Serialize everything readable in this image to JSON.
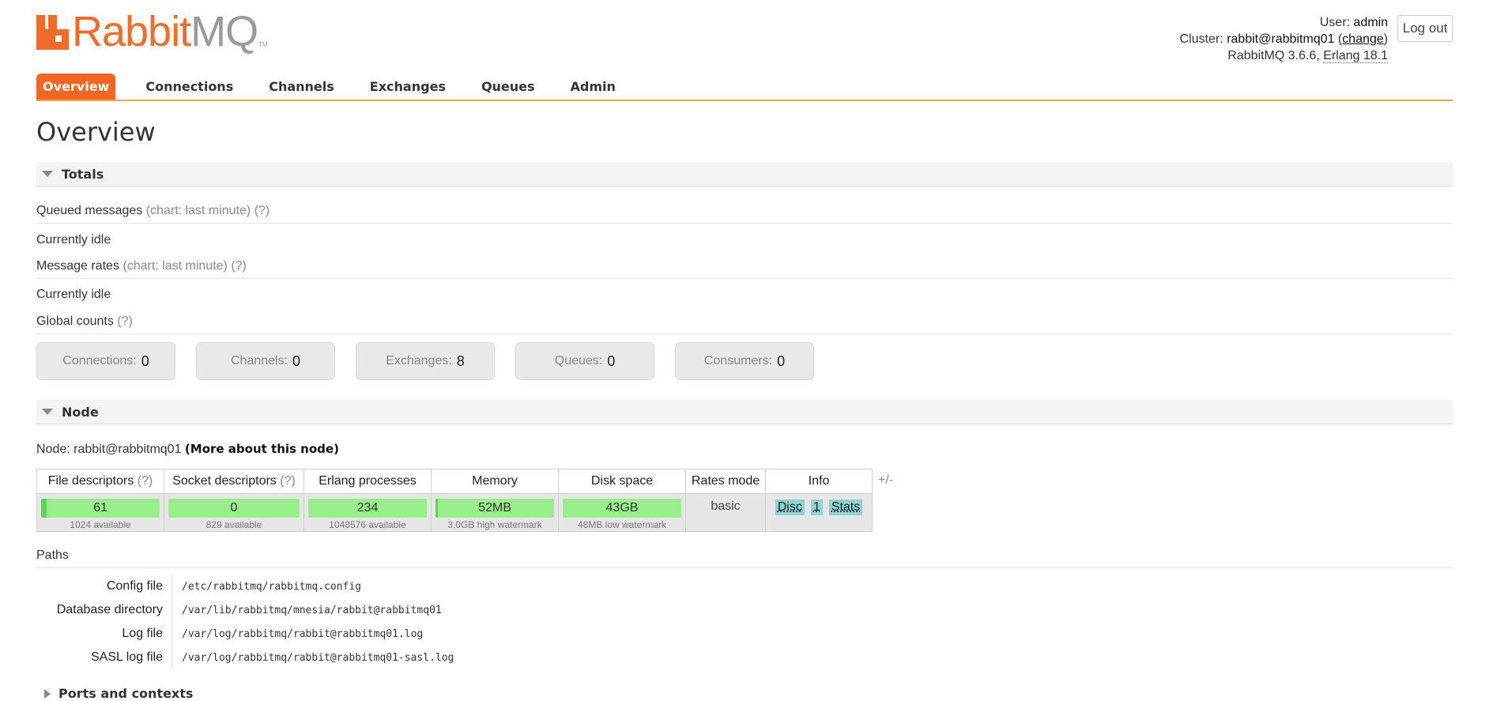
{
  "logo": {
    "rabbit": "Rabbit",
    "mq": "MQ",
    "tm": "TM"
  },
  "header": {
    "user_label": "User:",
    "user": "admin",
    "cluster_label": "Cluster:",
    "cluster": "rabbit@rabbitmq01",
    "change": "change",
    "version": "RabbitMQ 3.6.6,",
    "erlang": "Erlang 18.1",
    "logout": "Log out"
  },
  "tabs": [
    "Overview",
    "Connections",
    "Channels",
    "Exchanges",
    "Queues",
    "Admin"
  ],
  "page_title": "Overview",
  "totals": {
    "title": "Totals",
    "queued_messages": "Queued messages",
    "queued_chart": "(chart: last minute)",
    "help": "(?)",
    "queued_idle": "Currently idle",
    "message_rates": "Message rates",
    "rates_chart": "(chart: last minute)",
    "rates_idle": "Currently idle",
    "global_counts": "Global counts",
    "counts": [
      {
        "label": "Connections:",
        "value": "0"
      },
      {
        "label": "Channels:",
        "value": "0"
      },
      {
        "label": "Exchanges:",
        "value": "8"
      },
      {
        "label": "Queues:",
        "value": "0"
      },
      {
        "label": "Consumers:",
        "value": "0"
      }
    ]
  },
  "node": {
    "title": "Node",
    "node_label": "Node:",
    "node_name": "rabbit@rabbitmq01",
    "more": "(More about this node)",
    "headers": [
      "File descriptors",
      "Socket descriptors",
      "Erlang processes",
      "Memory",
      "Disk space",
      "Rates mode",
      "Info"
    ],
    "help": "(?)",
    "fd": {
      "value": "61",
      "sub": "1024 available"
    },
    "sockets": {
      "value": "0",
      "sub": "829 available"
    },
    "procs": {
      "value": "234",
      "sub": "1048576 available"
    },
    "memory": {
      "value": "52MB",
      "sub": "3.0GB high watermark"
    },
    "disk": {
      "value": "43GB",
      "sub": "48MB low watermark"
    },
    "rates_mode": "basic",
    "info": [
      "Disc",
      "1",
      "Stats"
    ],
    "plusminus": "+/-"
  },
  "paths": {
    "title": "Paths",
    "rows": [
      {
        "k": "Config file",
        "v": "/etc/rabbitmq/rabbitmq.config"
      },
      {
        "k": "Database directory",
        "v": "/var/lib/rabbitmq/mnesia/rabbit@rabbitmq01"
      },
      {
        "k": "Log file",
        "v": "/var/log/rabbitmq/rabbit@rabbitmq01.log"
      },
      {
        "k": "SASL log file",
        "v": "/var/log/rabbitmq/rabbit@rabbitmq01-sasl.log"
      }
    ]
  },
  "ports": {
    "title": "Ports and contexts"
  }
}
